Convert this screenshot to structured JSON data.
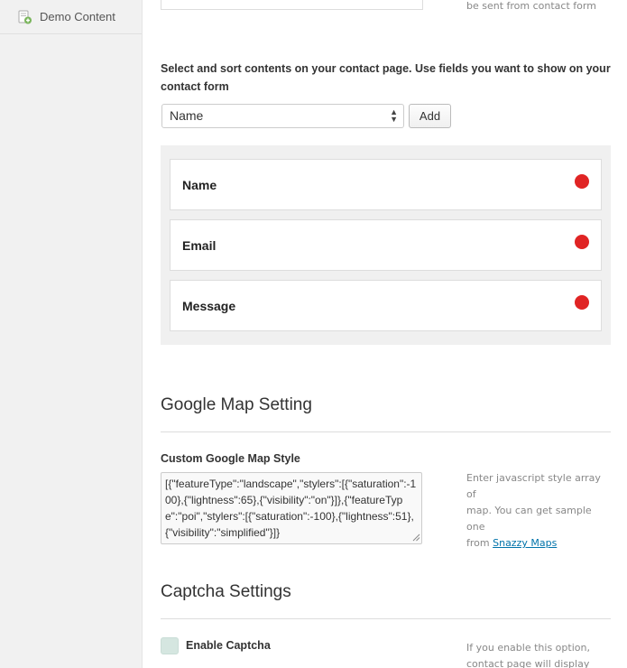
{
  "sidebar": {
    "items": [
      {
        "label": "Demo Content",
        "icon": "demo-content-icon"
      }
    ]
  },
  "contact_form_note": "be sent from contact form",
  "contents": {
    "description_line1": "Select and sort contents on your contact page. Use fields you want to show on your",
    "description_line2": "contact form",
    "select_value": "Name",
    "add_label": "Add",
    "fields": [
      {
        "label": "Name"
      },
      {
        "label": "Email"
      },
      {
        "label": "Message"
      }
    ],
    "remove_color": "#e02424"
  },
  "map": {
    "section_title": "Google Map Setting",
    "style_label": "Custom Google Map Style",
    "style_value": "[{\"featureType\":\"landscape\",\"stylers\":[{\"saturation\":-100},{\"lightness\":65},{\"visibility\":\"on\"}]},{\"featureType\":\"poi\",\"stylers\":[{\"saturation\":-100},{\"lightness\":51},{\"visibility\":\"simplified\"}]}",
    "help_line1": "Enter javascript style array of",
    "help_line2": "map. You can get sample one",
    "help_from": "from ",
    "help_link": "Snazzy Maps"
  },
  "captcha": {
    "section_title": "Captcha Settings",
    "enable_label": "Enable Captcha",
    "help_line1": "If you enable this option,",
    "help_line2": "contact page will display"
  }
}
